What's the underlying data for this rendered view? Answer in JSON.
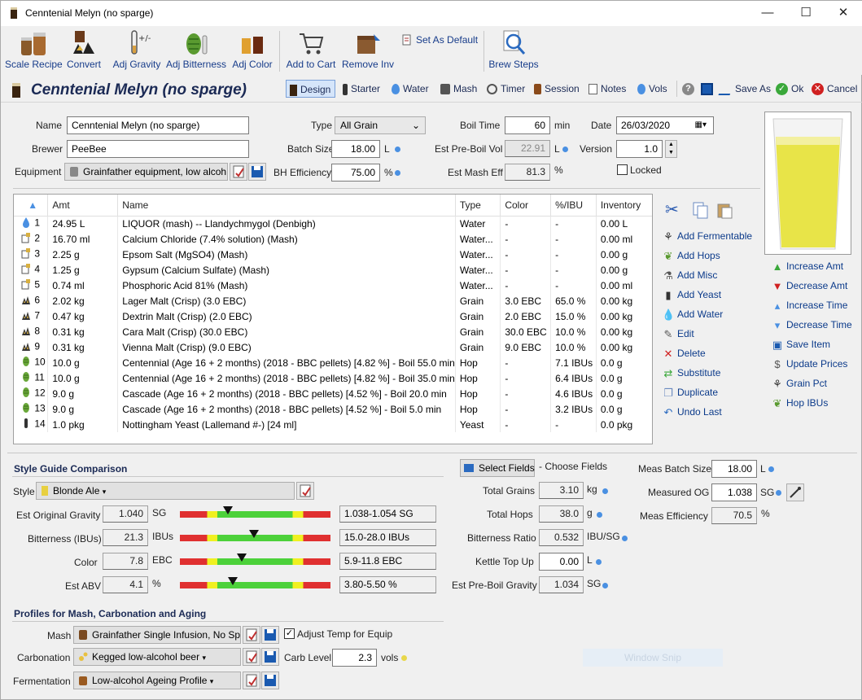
{
  "window": {
    "title": "Cenntenial Melyn (no sparge)",
    "min": "—",
    "max": "☐",
    "close": "✕"
  },
  "toolbar": [
    {
      "name": "scale-recipe",
      "label": "Scale Recipe"
    },
    {
      "name": "convert",
      "label": "Convert"
    },
    {
      "name": "adj-gravity",
      "label": "Adj Gravity"
    },
    {
      "name": "adj-bitterness",
      "label": "Adj Bitterness"
    },
    {
      "name": "adj-color",
      "label": "Adj Color"
    },
    {
      "name": "add-to-cart",
      "label": "Add to Cart"
    },
    {
      "name": "remove-inv",
      "label": "Remove Inv"
    },
    {
      "name": "set-as-default",
      "label": "Set As Default"
    },
    {
      "name": "brew-steps",
      "label": "Brew Steps"
    }
  ],
  "recipe_title": "Cenntenial Melyn (no sparge)",
  "nav": {
    "design": "Design",
    "starter": "Starter",
    "water": "Water",
    "mash": "Mash",
    "timer": "Timer",
    "session": "Session",
    "notes": "Notes",
    "vols": "Vols",
    "save_as": "Save As",
    "ok": "Ok",
    "cancel": "Cancel"
  },
  "form": {
    "name_label": "Name",
    "name": "Cenntenial Melyn (no sparge)",
    "brewer_label": "Brewer",
    "brewer": "PeeBee",
    "equipment_label": "Equipment",
    "equipment": "Grainfather equipment, low alcoh",
    "type_label": "Type",
    "type": "All Grain",
    "batch_label": "Batch Size",
    "batch": "18.00",
    "batch_unit": "L",
    "bh_label": "BH Efficiency",
    "bh": "75.00",
    "bh_unit": "%",
    "boil_label": "Boil Time",
    "boil": "60",
    "boil_unit": "min",
    "preboil_label": "Est Pre-Boil Vol",
    "preboil": "22.91",
    "preboil_unit": "L",
    "mash_eff_label": "Est Mash Eff",
    "mash_eff": "81.3",
    "mash_eff_unit": "%",
    "date_label": "Date",
    "date": "26/03/2020",
    "version_label": "Version",
    "version": "1.0",
    "locked_label": "Locked"
  },
  "table": {
    "headers": [
      "Amt",
      "Name",
      "Type",
      "Color",
      "%/IBU",
      "Inventory"
    ],
    "rows": [
      {
        "n": "1",
        "icon": "water",
        "amt": "24.95 L",
        "name": "LIQUOR (mash) -- Llandychmygol (Denbigh)",
        "type": "Water",
        "color": "-",
        "ibu": "-",
        "inv": "0.00 L"
      },
      {
        "n": "2",
        "icon": "misc",
        "amt": "16.70 ml",
        "name": "Calcium Chloride (7.4% solution) (Mash)",
        "type": "Water...",
        "color": "-",
        "ibu": "-",
        "inv": "0.00 ml"
      },
      {
        "n": "3",
        "icon": "misc",
        "amt": "2.25 g",
        "name": "Epsom Salt (MgSO4) (Mash)",
        "type": "Water...",
        "color": "-",
        "ibu": "-",
        "inv": "0.00 g"
      },
      {
        "n": "4",
        "icon": "misc",
        "amt": "1.25 g",
        "name": "Gypsum (Calcium Sulfate) (Mash)",
        "type": "Water...",
        "color": "-",
        "ibu": "-",
        "inv": "0.00 g"
      },
      {
        "n": "5",
        "icon": "misc",
        "amt": "0.74 ml",
        "name": "Phosphoric Acid 81% (Mash)",
        "type": "Water...",
        "color": "-",
        "ibu": "-",
        "inv": "0.00 ml"
      },
      {
        "n": "6",
        "icon": "grain",
        "amt": "2.02 kg",
        "name": "Lager Malt (Crisp) (3.0 EBC)",
        "type": "Grain",
        "color": "3.0 EBC",
        "ibu": "65.0 %",
        "inv": "0.00 kg"
      },
      {
        "n": "7",
        "icon": "grain",
        "amt": "0.47 kg",
        "name": "Dextrin Malt (Crisp) (2.0 EBC)",
        "type": "Grain",
        "color": "2.0 EBC",
        "ibu": "15.0 %",
        "inv": "0.00 kg"
      },
      {
        "n": "8",
        "icon": "grain",
        "amt": "0.31 kg",
        "name": "Cara Malt (Crisp) (30.0 EBC)",
        "type": "Grain",
        "color": "30.0 EBC",
        "ibu": "10.0 %",
        "inv": "0.00 kg"
      },
      {
        "n": "9",
        "icon": "grain",
        "amt": "0.31 kg",
        "name": "Vienna Malt (Crisp) (9.0 EBC)",
        "type": "Grain",
        "color": "9.0 EBC",
        "ibu": "10.0 %",
        "inv": "0.00 kg"
      },
      {
        "n": "10",
        "icon": "hop",
        "amt": "10.0 g",
        "name": "Centennial (Age 16 + 2 months) (2018 - BBC pellets) [4.82 %] - Boil 55.0 min",
        "type": "Hop",
        "color": "-",
        "ibu": "7.1 IBUs",
        "inv": "0.0 g"
      },
      {
        "n": "11",
        "icon": "hop",
        "amt": "10.0 g",
        "name": "Centennial (Age 16 + 2 months) (2018 - BBC pellets) [4.82 %] - Boil 35.0 min",
        "type": "Hop",
        "color": "-",
        "ibu": "6.4 IBUs",
        "inv": "0.0 g"
      },
      {
        "n": "12",
        "icon": "hop",
        "amt": "9.0 g",
        "name": "Cascade (Age 16 + 2 months) (2018 - BBC pellets) [4.52 %] - Boil 20.0 min",
        "type": "Hop",
        "color": "-",
        "ibu": "4.6 IBUs",
        "inv": "0.0 g"
      },
      {
        "n": "13",
        "icon": "hop",
        "amt": "9.0 g",
        "name": "Cascade (Age 16 + 2 months) (2018 - BBC pellets) [4.52 %] - Boil 5.0 min",
        "type": "Hop",
        "color": "-",
        "ibu": "3.2 IBUs",
        "inv": "0.0 g"
      },
      {
        "n": "14",
        "icon": "yeast",
        "amt": "1.0 pkg",
        "name": "Nottingham Yeast (Lallemand #-) [24 ml]",
        "type": "Yeast",
        "color": "-",
        "ibu": "-",
        "inv": "0.0 pkg"
      }
    ]
  },
  "actions": [
    "Add Fermentable",
    "Add Hops",
    "Add Misc",
    "Add Yeast",
    "Add Water",
    "Edit",
    "Delete",
    "Substitute",
    "Duplicate",
    "Undo Last"
  ],
  "right_actions": [
    "Increase Amt",
    "Decrease Amt",
    "Increase Time",
    "Decrease Time",
    "Save Item",
    "Update Prices",
    "Grain Pct",
    "Hop IBUs"
  ],
  "style": {
    "section": "Style Guide Comparison",
    "style_label": "Style",
    "style": "Blonde Ale",
    "rows": [
      {
        "label": "Est Original Gravity",
        "value": "1.040",
        "unit": "SG",
        "range": "1.038-1.054 SG",
        "pos": 0.32
      },
      {
        "label": "Bitterness (IBUs)",
        "value": "21.3",
        "unit": "IBUs",
        "range": "15.0-28.0 IBUs",
        "pos": 0.49
      },
      {
        "label": "Color",
        "value": "7.8",
        "unit": "EBC",
        "range": "5.9-11.8 EBC",
        "pos": 0.41
      },
      {
        "label": "Est ABV",
        "value": "4.1",
        "unit": "%",
        "range": "3.80-5.50 %",
        "pos": 0.35
      }
    ]
  },
  "stats": {
    "select_fields": "Select Fields",
    "choose_fields": "- Choose Fields",
    "rows": [
      {
        "label": "Total Grains",
        "value": "3.10",
        "unit": "kg"
      },
      {
        "label": "Total Hops",
        "value": "38.0",
        "unit": "g"
      },
      {
        "label": "Bitterness Ratio",
        "value": "0.532",
        "unit": "IBU/SG"
      },
      {
        "label": "Kettle Top Up",
        "value": "0.00",
        "unit": "L"
      },
      {
        "label": "Est Pre-Boil Gravity",
        "value": "1.034",
        "unit": "SG"
      }
    ]
  },
  "meas": {
    "batch_label": "Meas Batch Size",
    "batch": "18.00",
    "batch_unit": "L",
    "og_label": "Measured OG",
    "og": "1.038",
    "og_unit": "SG",
    "eff_label": "Meas Efficiency",
    "eff": "70.5",
    "eff_unit": "%"
  },
  "profiles": {
    "section": "Profiles for Mash, Carbonation and Aging",
    "mash_label": "Mash",
    "mash": "Grainfather Single Infusion, No Spa",
    "adjust_label": "Adjust Temp for Equip",
    "carb_label": "Carbonation",
    "carb": "Kegged low-alcohol beer",
    "carb_level_label": "Carb Level",
    "carb_level": "2.3",
    "carb_unit": "vols",
    "ferm_label": "Fermentation",
    "ferm": "Low-alcohol Ageing Profile"
  },
  "window_snip": "Window Snip",
  "colors": {
    "beer": "#e8e448",
    "accent": "#1b2a55"
  }
}
